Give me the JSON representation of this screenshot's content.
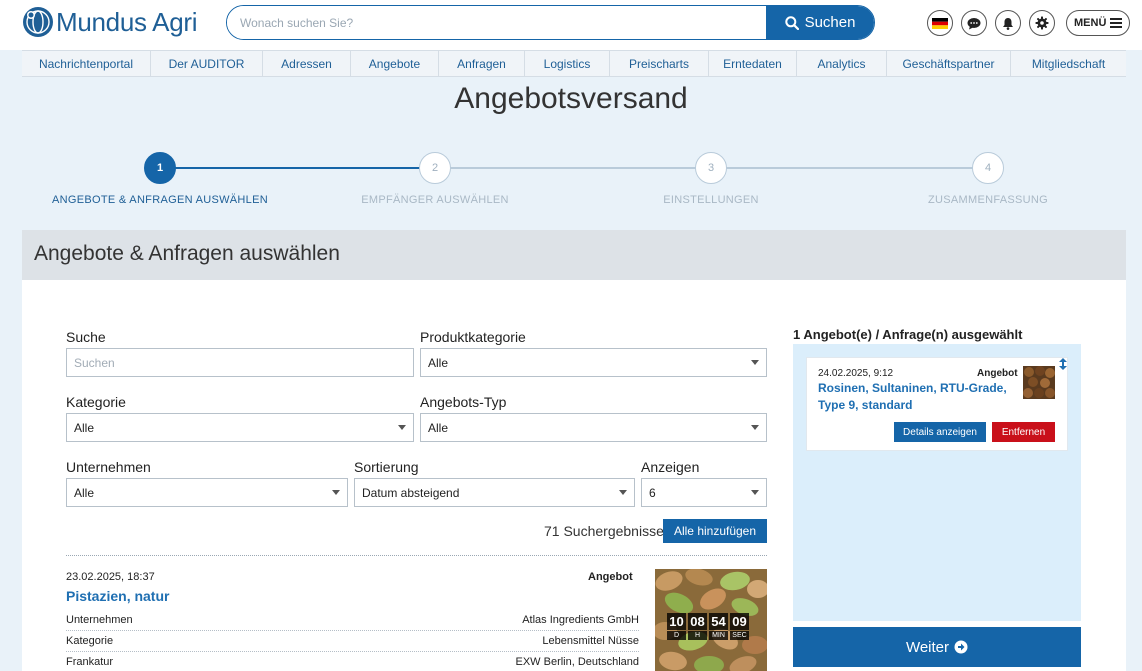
{
  "brand": {
    "name": "Mundus Agri"
  },
  "search": {
    "placeholder": "Wonach suchen Sie?",
    "button_label": "Suchen"
  },
  "header": {
    "menu_label": "MENÜ",
    "icons": [
      "flag-de-icon",
      "chat-icon",
      "bell-icon",
      "gear-icon",
      "hamburger-icon"
    ]
  },
  "nav": {
    "items": [
      {
        "label": "Nachrichtenportal"
      },
      {
        "label": "Der AUDITOR"
      },
      {
        "label": "Adressen"
      },
      {
        "label": "Angebote"
      },
      {
        "label": "Anfragen"
      },
      {
        "label": "Logistics"
      },
      {
        "label": "Preischarts"
      },
      {
        "label": "Erntedaten"
      },
      {
        "label": "Analytics"
      },
      {
        "label": "Geschäftspartner"
      },
      {
        "label": "Mitgliedschaft"
      }
    ]
  },
  "page": {
    "title": "Angebotsversand"
  },
  "stepper": {
    "active_step": 1,
    "steps": [
      {
        "number": "1",
        "label": "ANGEBOTE & ANFRAGEN AUSWÄHLEN"
      },
      {
        "number": "2",
        "label": "EMPFÄNGER AUSWÄHLEN"
      },
      {
        "number": "3",
        "label": "EINSTELLUNGEN"
      },
      {
        "number": "4",
        "label": "ZUSAMMENFASSUNG"
      }
    ]
  },
  "section": {
    "title": "Angebote & Anfragen auswählen"
  },
  "filters": {
    "suche": {
      "label": "Suche",
      "placeholder": "Suchen"
    },
    "produktkategorie": {
      "label": "Produktkategorie",
      "value": "Alle"
    },
    "kategorie": {
      "label": "Kategorie",
      "value": "Alle"
    },
    "angebotstyp": {
      "label": "Angebots-Typ",
      "value": "Alle"
    },
    "unternehmen": {
      "label": "Unternehmen",
      "value": "Alle"
    },
    "sortierung": {
      "label": "Sortierung",
      "value": "Datum absteigend"
    },
    "anzeigen": {
      "label": "Anzeigen",
      "value": "6"
    }
  },
  "results": {
    "count_text": "71 Suchergebnisse",
    "add_all_label": "Alle hinzufügen",
    "items": [
      {
        "date": "23.02.2025, 18:37",
        "type": "Angebot",
        "title": "Pistazien, natur",
        "rows": [
          {
            "key": "Unternehmen",
            "value": "Atlas Ingredients GmbH"
          },
          {
            "key": "Kategorie",
            "value": "Lebensmittel Nüsse"
          },
          {
            "key": "Frankatur",
            "value": "EXW Berlin, Deutschland"
          }
        ],
        "countdown": [
          {
            "value": "10",
            "unit": "D"
          },
          {
            "value": "08",
            "unit": "H"
          },
          {
            "value": "54",
            "unit": "MIN"
          },
          {
            "value": "09",
            "unit": "SEC"
          }
        ]
      }
    ]
  },
  "selection": {
    "title": "1 Angebot(e) / Anfrage(n) ausgewählt",
    "items": [
      {
        "date": "24.02.2025, 9:12",
        "type": "Angebot",
        "title": "Rosinen, Sultaninen, RTU-Grade, Type 9, standard",
        "details_label": "Details anzeigen",
        "remove_label": "Entfernen"
      }
    ],
    "continue_label": "Weiter"
  },
  "colors": {
    "primary": "#1565a8",
    "danger": "#c9101a",
    "page_bg": "#e9f2f9",
    "panel_bg": "#dbeefb"
  }
}
